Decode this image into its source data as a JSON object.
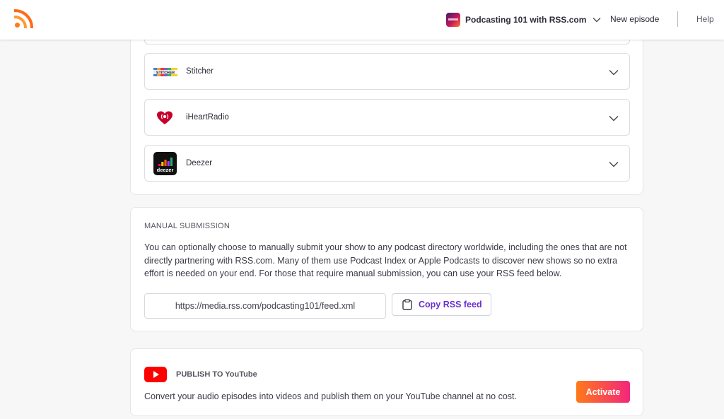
{
  "header": {
    "logo_icon": "rss-icon",
    "podcast_name": "Podcasting 101 with RSS.com",
    "new_episode": "New episode",
    "help": "Help"
  },
  "platforms": [
    {
      "name": "Stitcher",
      "icon": "stitcher-logo-icon"
    },
    {
      "name": "iHeartRadio",
      "icon": "iheartradio-logo-icon"
    },
    {
      "name": "Deezer",
      "icon": "deezer-logo-icon",
      "logo_text": "deezer"
    }
  ],
  "manual_submission": {
    "title": "MANUAL SUBMISSION",
    "description": "You can optionally choose to manually submit your show to any podcast directory worldwide, including the ones that are not directly partnering with RSS.com. Many of them use Podcast Index or Apple Podcasts to discover new shows so no extra effort is needed on your end. For those that require manual submission, you can use your RSS feed below.",
    "feed_url": "https://media.rss.com/podcasting101/feed.xml",
    "copy_button": "Copy RSS feed"
  },
  "youtube": {
    "title": "PUBLISH TO YouTube",
    "description": "Convert your audio episodes into videos and publish them on your YouTube channel at no cost.",
    "activate_button": "Activate"
  },
  "colors": {
    "accent_purple": "#6a2fd0",
    "rss_orange": "#ff7a1a",
    "activate_gradient_start": "#ff7a1a",
    "activate_gradient_end": "#f2267d",
    "youtube_red": "#ff0000",
    "iheart_red": "#c6002b"
  }
}
